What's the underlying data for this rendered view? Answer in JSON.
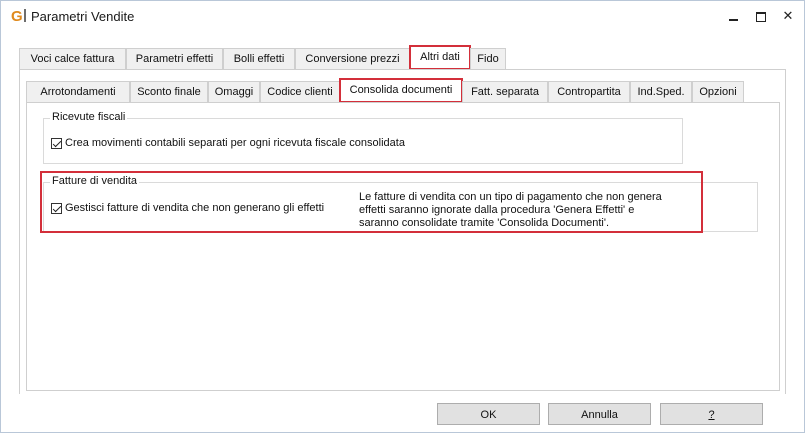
{
  "window": {
    "title": "Parametri Vendite",
    "icon": "app-logo-icon"
  },
  "tabs_top": [
    "Voci calce fattura",
    "Parametri effetti",
    "Bolli effetti",
    "Conversione prezzi",
    "Altri dati",
    "Fido"
  ],
  "tabs_top_active": "Altri dati",
  "tabs_sub": [
    "Arrotondamenti",
    "Sconto finale",
    "Omaggi",
    "Codice clienti",
    "Consolida documenti",
    "Fatt. separata",
    "Contropartita",
    "Ind.Sped.",
    "Opzioni"
  ],
  "tabs_sub_active": "Consolida documenti",
  "group_ricevute": {
    "label": "Ricevute fiscali",
    "checkbox_label": "Crea movimenti contabili separati per ogni ricevuta fiscale consolidata",
    "checked": true
  },
  "group_fatture": {
    "label": "Fatture di vendita",
    "checkbox_label": "Gestisci fatture di vendita che non generano gli effetti",
    "checked": true,
    "note_lines": [
      "Le fatture di vendita con un tipo di pagamento che non genera",
      "effetti saranno ignorate dalla procedura 'Genera Effetti' e",
      "saranno consolidate tramite 'Consolida Documenti'."
    ]
  },
  "buttons": {
    "ok": "OK",
    "cancel": "Annulla",
    "help": "?"
  },
  "colors": {
    "highlight": "#d32f3a",
    "tab_bg": "#f0f0f0",
    "button_bg": "#e1e1e1"
  }
}
